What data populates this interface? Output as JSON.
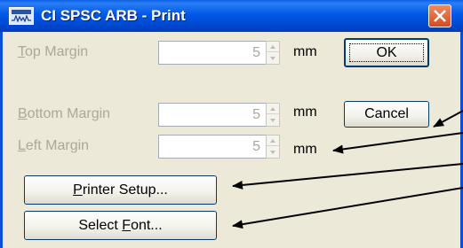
{
  "window": {
    "title": "CI SPSC ARB - Print",
    "close_icon": "close-icon",
    "app_icon": "app-signal-icon"
  },
  "fields": [
    {
      "label_accel": "T",
      "label_rest": "op Margin",
      "value": "5",
      "unit": "mm"
    },
    {
      "label_accel": "B",
      "label_rest": "ottom Margin",
      "value": "5",
      "unit": "mm"
    },
    {
      "label_accel": "L",
      "label_rest": "eft Margin",
      "value": "5",
      "unit": "mm"
    }
  ],
  "buttons": {
    "ok": "OK",
    "cancel": "Cancel",
    "printer_setup_accel": "P",
    "printer_setup_rest": "rinter Setup...",
    "select_font_pre": "Select ",
    "select_font_accel": "F",
    "select_font_rest": "ont..."
  },
  "colors": {
    "titlebar": "#0058e6",
    "dialog_bg": "#ece9d8",
    "disabled_text": "#aca899",
    "close_button": "#d54a20"
  }
}
